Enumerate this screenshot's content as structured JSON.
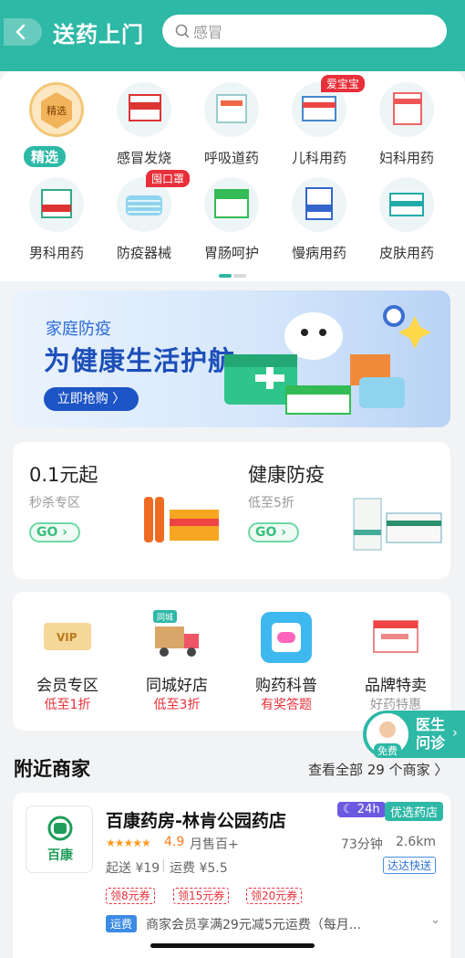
{
  "header": {
    "title": "送药上门",
    "search_value": "感冒",
    "color": "#2eb8a6"
  },
  "categories": [
    {
      "label": "精选",
      "selected": true,
      "icon": "featured-icon",
      "icon_text": "精选"
    },
    {
      "label": "感冒发烧",
      "icon": "cold-medicine-icon"
    },
    {
      "label": "呼吸道药",
      "icon": "respiratory-medicine-icon"
    },
    {
      "label": "儿科用药",
      "icon": "pediatric-medicine-icon",
      "badge": "爱宝宝"
    },
    {
      "label": "妇科用药",
      "icon": "gynecology-medicine-icon"
    },
    {
      "label": "男科用药",
      "icon": "mens-medicine-icon"
    },
    {
      "label": "防疫器械",
      "icon": "mask-icon",
      "badge": "囤口罩"
    },
    {
      "label": "胃肠呵护",
      "icon": "stomach-medicine-icon"
    },
    {
      "label": "慢病用药",
      "icon": "chronic-medicine-icon"
    },
    {
      "label": "皮肤用药",
      "icon": "skin-medicine-icon"
    }
  ],
  "banner": {
    "subtitle": "家庭防疫",
    "title": "为健康生活护航",
    "button": "立即抢购"
  },
  "promos": [
    {
      "title": "0.1元起",
      "subtitle": "秒杀专区",
      "go": "GO"
    },
    {
      "title": "健康防疫",
      "subtitle": "低至5折",
      "go": "GO"
    }
  ],
  "services": [
    {
      "name": "会员专区",
      "desc": "低至1折",
      "icon": "vip-icon",
      "icon_text": "VIP"
    },
    {
      "name": "同城好店",
      "desc": "低至3折",
      "icon": "delivery-truck-icon",
      "tag": "同城"
    },
    {
      "name": "购药科普",
      "desc": "有奖答题",
      "icon": "medicine-science-icon"
    },
    {
      "name": "品牌特卖",
      "desc": "好药特惠",
      "icon": "brand-sale-icon"
    }
  ],
  "doctor": {
    "label": "医生问诊",
    "badge": "免费"
  },
  "nearby": {
    "title": "附近商家",
    "view_all": "查看全部 29 个商家 〉"
  },
  "store": {
    "logo_text": "百康",
    "name": "百康药房-林肯公园药店",
    "tag_24h": "24h",
    "tag_preferred": "优选药店",
    "stars": "★★★★★",
    "rating": "4.9",
    "monthly_sales": "月售百+",
    "delivery_time": "73分钟",
    "distance": "2.6km",
    "min_order": "起送 ¥19",
    "separator": "|",
    "shipping_fee": "运费 ¥5.5",
    "fast_tag": "达达快送",
    "coupons": [
      "领8元券",
      "领15元券",
      "领20元券"
    ],
    "shipping_tag": "运费",
    "shipping_desc": "商家会员享满29元减5元运费（每月..."
  }
}
